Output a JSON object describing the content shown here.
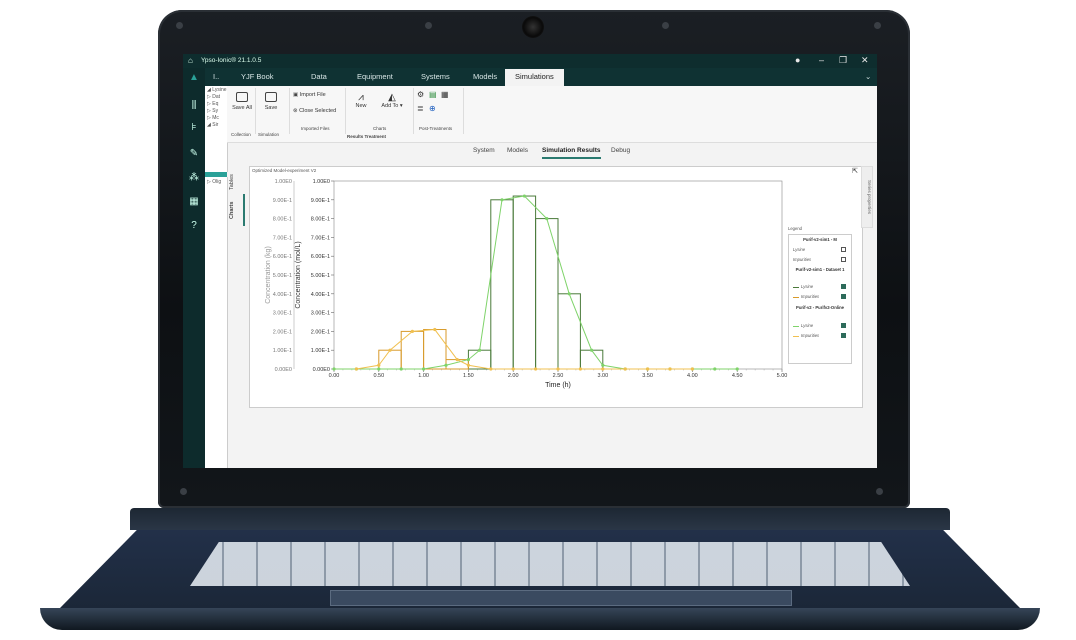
{
  "app": {
    "title": "Ypso-Ionic® 21.1.0.5"
  },
  "left_nav": {
    "collapsed_label": "I..",
    "icons": [
      "home-icon",
      "logo-icon",
      "library-icon",
      "tree-icon",
      "pencil-icon",
      "molecule-icon",
      "calculator-icon",
      "help-icon"
    ]
  },
  "tabs": [
    "YJF Book",
    "Data",
    "Equipment",
    "Systems",
    "Models",
    "Simulations"
  ],
  "active_tab": "Simulations",
  "tree": [
    "◢ Lysine",
    "▷ Dat",
    "▷ Eq",
    "▷ Sy",
    "▷ Mc",
    "◢ Sir"
  ],
  "tree_lower": "▷ Olig",
  "ribbon": {
    "save_all": "Save All",
    "save": "Save",
    "collection_label": "Collection",
    "simulation_label": "Simulation",
    "import_file": "Import File",
    "close_selected": "Close Selected",
    "imported_files_label": "Imported Files",
    "new": "New",
    "add_to": "Add To ▾",
    "charts_label": "Charts",
    "post_treatments_label": "Post-Treatments",
    "results_treatment_label": "Results Treatment"
  },
  "subtabs": [
    "System",
    "Models",
    "Simulation Results",
    "Debug"
  ],
  "active_subtab": "Simulation Results",
  "side_tabs": {
    "tables": "Tables",
    "charts": "Charts"
  },
  "panel": {
    "title": "Optimized Model-experiment V2",
    "right_tab": "Series properties"
  },
  "legend": {
    "title": "Legend",
    "groups": [
      {
        "name": "Purif-v2-sim1 - M",
        "items": [
          {
            "label": "Lysine",
            "checked": false
          },
          {
            "label": "Impurities",
            "checked": false
          }
        ]
      },
      {
        "name": "Purif-v2-sim1 - Dataset 1",
        "items": [
          {
            "label": "Lysine",
            "checked": true
          },
          {
            "label": "Impurities",
            "checked": true
          }
        ]
      },
      {
        "name": "Purif-v2 - Purifv2-Online",
        "items": [
          {
            "label": "Lysine",
            "checked": true
          },
          {
            "label": "Impurities",
            "checked": true
          }
        ]
      }
    ]
  },
  "colors": {
    "lysine_dark": "#4a7a3a",
    "lysine_light": "#7fd36a",
    "impurity": "#d89a2a",
    "impurity_light": "#f0c050",
    "accent": "#2aa198"
  },
  "chart_data": {
    "type": "line",
    "xlabel": "Time (h)",
    "ylabel_left": "Concentration (kg)",
    "ylabel_right": "Concentration (mol/L)",
    "x_ticks": [
      "0.00",
      "0.50",
      "1.00",
      "1.50",
      "2.00",
      "2.50",
      "3.00",
      "3.50",
      "4.00",
      "4.50",
      "5.00"
    ],
    "y_ticks_left": [
      "0.00E0",
      "1.00E-1",
      "2.00E-1",
      "3.00E-1",
      "4.00E-1",
      "5.00E-1",
      "6.00E-1",
      "7.00E-1",
      "8.00E-1",
      "9.00E-1",
      "1.00E0"
    ],
    "y_ticks_right": [
      "0.00E0",
      "1.00E-1",
      "2.00E-1",
      "3.00E-1",
      "4.00E-1",
      "5.00E-1",
      "6.00E-1",
      "7.00E-1",
      "8.00E-1",
      "9.00E-1",
      "1.00E0"
    ],
    "xlim": [
      0,
      5
    ],
    "ylim": [
      0,
      1
    ],
    "series": [
      {
        "name": "Lysine",
        "kind": "bars",
        "bins": [
          [
            1.5,
            1.75,
            0.1
          ],
          [
            1.75,
            2.0,
            0.9
          ],
          [
            2.0,
            2.25,
            0.92
          ],
          [
            2.25,
            2.5,
            0.8
          ],
          [
            2.5,
            2.75,
            0.4
          ],
          [
            2.75,
            3.0,
            0.1
          ]
        ]
      },
      {
        "name": "Impurities",
        "kind": "bars",
        "bins": [
          [
            0.5,
            0.75,
            0.1
          ],
          [
            0.75,
            1.0,
            0.2
          ],
          [
            1.0,
            1.25,
            0.21
          ],
          [
            1.25,
            1.5,
            0.05
          ]
        ]
      },
      {
        "name": "Lysine",
        "kind": "line",
        "x": [
          0.0,
          0.25,
          0.5,
          0.75,
          1.0,
          1.25,
          1.5,
          1.625,
          1.875,
          2.125,
          2.375,
          2.625,
          2.875,
          3.0,
          3.25,
          3.5,
          3.75,
          4.0,
          4.25,
          4.5
        ],
        "y": [
          0.0,
          0.0,
          0.0,
          0.0,
          0.0,
          0.02,
          0.05,
          0.1,
          0.9,
          0.92,
          0.8,
          0.4,
          0.1,
          0.02,
          0.0,
          0.0,
          0.0,
          0.0,
          0.0,
          0.0
        ]
      },
      {
        "name": "Impurities",
        "kind": "line",
        "x": [
          0.25,
          0.5,
          0.625,
          0.875,
          1.125,
          1.375,
          1.5,
          1.75,
          2.0,
          2.25,
          2.5,
          2.75,
          3.0,
          3.25,
          3.5,
          3.75,
          4.0
        ],
        "y": [
          0.0,
          0.02,
          0.1,
          0.2,
          0.21,
          0.05,
          0.02,
          0.0,
          0.0,
          0.0,
          0.0,
          0.0,
          0.0,
          0.0,
          0.0,
          0.0,
          0.0
        ]
      }
    ]
  }
}
